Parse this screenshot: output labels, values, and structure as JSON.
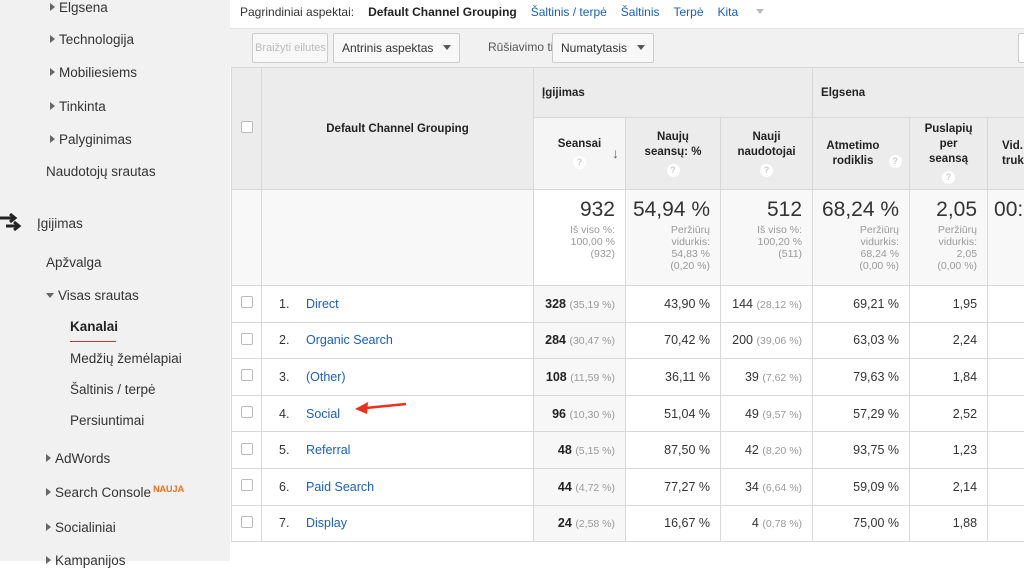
{
  "sidebar": {
    "items": [
      {
        "label": "Elgsena"
      },
      {
        "label": "Technologija"
      },
      {
        "label": "Mobiliesiems"
      },
      {
        "label": "Tinkinta"
      },
      {
        "label": "Palyginimas"
      },
      {
        "label": "Naudotojų srautas"
      },
      {
        "label": "Įgijimas"
      },
      {
        "label": "Apžvalga"
      },
      {
        "label": "Visas srautas"
      },
      {
        "label": "Kanalai"
      },
      {
        "label": "Medžių žemėlapiai"
      },
      {
        "label": "Šaltinis / terpė"
      },
      {
        "label": "Persiuntimai"
      },
      {
        "label": "AdWords"
      },
      {
        "label": "Search Console"
      },
      {
        "label": "Socialiniai"
      },
      {
        "label": "Kampanijos"
      }
    ],
    "new_badge": "NAUJA"
  },
  "topbar": {
    "label": "Pagrindiniai aspektai:",
    "active": "Default Channel Grouping",
    "links": [
      "Šaltinis / terpė",
      "Šaltinis",
      "Terpė",
      "Kita"
    ]
  },
  "toolbar": {
    "plot_rows": "Braižyti eilutes",
    "secondary": "Antrinis aspektas",
    "sort_label": "Rūšiavimo tipas:",
    "sort_value": "Numatytasis"
  },
  "table": {
    "dimension_header": "Default Channel Grouping",
    "groups": [
      "Įgijimas",
      "Elgsena"
    ],
    "columns": [
      "Seansai",
      "Naujų seansų: %",
      "Nauji naudotojai",
      "Atmetimo rodiklis",
      "Puslapių per seansą",
      "Vid. truk"
    ],
    "totals": [
      {
        "value": "932",
        "sub": [
          "Iš viso %:",
          "100,00 %",
          "(932)"
        ]
      },
      {
        "value": "54,94 %",
        "sub": [
          "Peržiūrų",
          "vidurkis:",
          "54,83 %",
          "(0,20 %)"
        ]
      },
      {
        "value": "512",
        "sub": [
          "Iš viso %:",
          "100,20 %",
          "(511)"
        ]
      },
      {
        "value": "68,24 %",
        "sub": [
          "Peržiūrų",
          "vidurkis:",
          "68,24 %",
          "(0,00 %)"
        ]
      },
      {
        "value": "2,05",
        "sub": [
          "Peržiūrų",
          "vidurkis:",
          "2,05",
          "(0,00 %)"
        ]
      },
      {
        "value": "00:"
      }
    ],
    "rows": [
      {
        "n": "1.",
        "name": "Direct",
        "sessions": "328",
        "sessions_pct": "(35,19 %)",
        "new_pct": "43,90 %",
        "new_users": "144",
        "new_users_pct": "(28,12 %)",
        "bounce": "69,21 %",
        "pages": "1,95"
      },
      {
        "n": "2.",
        "name": "Organic Search",
        "sessions": "284",
        "sessions_pct": "(30,47 %)",
        "new_pct": "70,42 %",
        "new_users": "200",
        "new_users_pct": "(39,06 %)",
        "bounce": "63,03 %",
        "pages": "2,24"
      },
      {
        "n": "3.",
        "name": "(Other)",
        "sessions": "108",
        "sessions_pct": "(11,59 %)",
        "new_pct": "36,11 %",
        "new_users": "39",
        "new_users_pct": "(7,62 %)",
        "bounce": "79,63 %",
        "pages": "1,84"
      },
      {
        "n": "4.",
        "name": "Social",
        "sessions": "96",
        "sessions_pct": "(10,30 %)",
        "new_pct": "51,04 %",
        "new_users": "49",
        "new_users_pct": "(9,57 %)",
        "bounce": "57,29 %",
        "pages": "2,52"
      },
      {
        "n": "5.",
        "name": "Referral",
        "sessions": "48",
        "sessions_pct": "(5,15 %)",
        "new_pct": "87,50 %",
        "new_users": "42",
        "new_users_pct": "(8,20 %)",
        "bounce": "93,75 %",
        "pages": "1,23"
      },
      {
        "n": "6.",
        "name": "Paid Search",
        "sessions": "44",
        "sessions_pct": "(4,72 %)",
        "new_pct": "77,27 %",
        "new_users": "34",
        "new_users_pct": "(6,64 %)",
        "bounce": "59,09 %",
        "pages": "2,14"
      },
      {
        "n": "7.",
        "name": "Display",
        "sessions": "24",
        "sessions_pct": "(2,58 %)",
        "new_pct": "16,67 %",
        "new_users": "4",
        "new_users_pct": "(0,78 %)",
        "bounce": "75,00 %",
        "pages": "1,88"
      }
    ]
  },
  "colors": {
    "link": "#1a5fb4",
    "badge": "#e8711c",
    "arrow": "#e8321e"
  }
}
